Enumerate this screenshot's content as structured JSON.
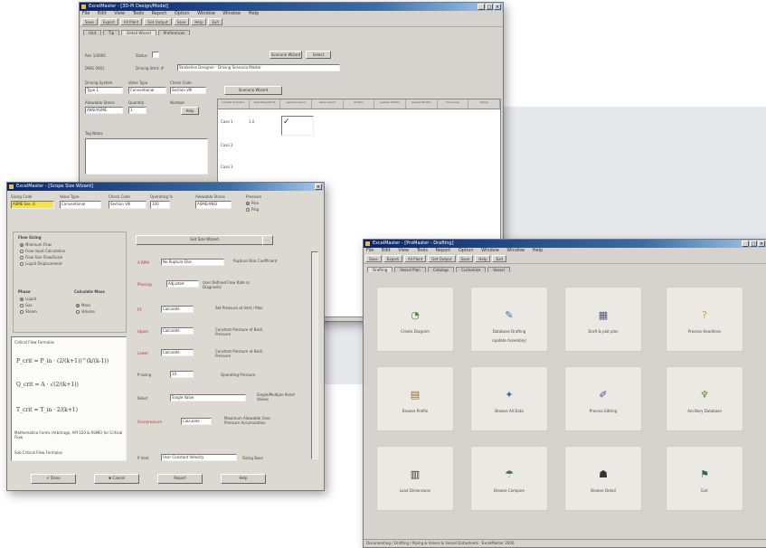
{
  "back_window": {
    "title": "ExcelMaster - [3D-Pi Design/Model]",
    "menu": [
      "File",
      "Edit",
      "View",
      "Tools",
      "Report",
      "Option",
      "Window",
      "Window",
      "Help"
    ],
    "toolbar": [
      "Save",
      "Export",
      "All Plant",
      "Get Output",
      "Save",
      "Help",
      "Exit"
    ],
    "tabs": [
      "Unit",
      "Tip",
      "Detail Wizard",
      "Preferences"
    ],
    "fields": {
      "rev": "Rev 1/2000",
      "dwg_no": "DWG 0001",
      "status_label": "Status",
      "driving_stmt_label": "Driving Stmt. #",
      "driving_stmt_value": "Strokeline Designer · Driving Scenario Master",
      "drive_type_label": "Driving System",
      "drive_type_value": "Type 1",
      "valve_type_label": "Valve Type",
      "valve_type_value": "Conventional",
      "check_code_label": "Check Code",
      "check_code_value": "Section VIII",
      "allowable_label": "Allowable Stress",
      "allowable_value": "ANSI/ASME",
      "quantity_label": "Quantity",
      "quantity_value": "1",
      "number_label": "Number",
      "tag_notes_label": "Tag Notes",
      "scenario_wizard": "Scenario Wizard",
      "help_btn": "Help",
      "select_btn": "Select"
    },
    "grid_headers": [
      "Leaded Scenario",
      "Operating Mode",
      "Leaded Liquid",
      "Valve Liquid",
      "Molten",
      "Leaded Molten",
      "Leaded Molten",
      "Flow Area",
      "Sizing"
    ],
    "grid_rows": [
      "Case 1",
      "Case 2",
      "Case 3"
    ],
    "grid_value": "1.0",
    "check_mark": "✓"
  },
  "front_left_window": {
    "title": "ExcelMaster - [Scope Size Wizard]",
    "fields": {
      "sizing_code_label": "Sizing Code",
      "sizing_code_value": "ASME Sec. 8",
      "valve_type_label": "Valve Type",
      "valve_type_value": "Conventional",
      "check_code_label": "Check Code",
      "check_code_value": "Section VIII",
      "operating_label": "Operating %",
      "operating_value": "100",
      "allowable_label": "Allowable Stress",
      "allowable_value": "ASME/ANSI",
      "pressure_label": "Pressure",
      "pressure_opts": [
        "Psia",
        "Psig"
      ]
    },
    "flow_group": {
      "title": "Flow Sizing",
      "options": [
        "Minimum Flow",
        "Flow Input Calculation",
        "Flow Size Flow/Scale",
        "Liquid Displacement"
      ]
    },
    "phase_group": {
      "title": "Phase",
      "options": [
        "Liquid",
        "Gas",
        "Steam"
      ]
    },
    "calc_group": {
      "title": "Calculate Mass",
      "options": [
        "Mass",
        "Volume"
      ]
    },
    "critical_label": "Critical Flow Formulas",
    "formulas": [
      "P_crit = P_in · (2/(k+1))^(k/(k-1))",
      "Q_crit = A · √(2/(k+1))",
      "T_crit = T_in · 2/(k+1)"
    ],
    "formula_note": "Mathematica Forms (Arbitrage, API 520 & ASME) for Critical Flow",
    "formula_footer": "Sub Critical Flow Formulas",
    "right_panel": {
      "button": "Get Size Wizard",
      "rows": [
        {
          "label": "A RPM",
          "value": "No Rupture Disc",
          "note": "Rupture Disk Coefficient"
        },
        {
          "label": "Phasing",
          "value": "Adjusted",
          "note": "User Defined Flow Rate or Diagnostic"
        },
        {
          "label": "P1",
          "value": "Calculate",
          "note": "Set Pressure at Inlet / Max"
        },
        {
          "label": "Upper",
          "value": "Calculate",
          "note": "Constant Pressure of Back Pressure"
        },
        {
          "label": "Lower",
          "value": "Calculate",
          "note": "Constant Pressure at Back Pressure"
        },
        {
          "label": "P-sizing",
          "value": "10",
          "note": "Operating Pressure"
        },
        {
          "label": "Relief",
          "value": "Single Valve",
          "note": "Single/Multiple Relief Valves"
        },
        {
          "label": "Overpressure",
          "value": "Calculate",
          "note": "Maximum Allowable Over Pressure Accumulation"
        },
        {
          "label": "P Inlet",
          "value": "User Constant Velocity",
          "note": "Sizing Base"
        }
      ]
    },
    "buttons": [
      "Done",
      "Cancel",
      "Report",
      "Help"
    ]
  },
  "front_right_window": {
    "title": "ExcelMaster - [ProMaster - Drafting]",
    "menu": [
      "File",
      "Edit",
      "View",
      "Tools",
      "Report",
      "Option",
      "Window",
      "Window",
      "Help"
    ],
    "toolbar": [
      "Save",
      "Export",
      "All Plant",
      "Get Output",
      "Save",
      "Help",
      "Exit"
    ],
    "tabs": [
      "Drafting",
      "Vessel Plan",
      "Catalogs",
      "Customize",
      "Vessel"
    ],
    "tiles": [
      {
        "icon": "◔",
        "color": "#4a8a3a",
        "label": "Create Diagram"
      },
      {
        "icon": "✎",
        "color": "#3a6a9a",
        "label": "Database Drafting",
        "sub": "(update Assembly)"
      },
      {
        "icon": "▦",
        "color": "#555577",
        "label": "Draft & plot plan"
      },
      {
        "icon": "?",
        "color": "#c8a030",
        "label": "Process Headlines"
      },
      {
        "icon": "▤",
        "color": "#8a6a2a",
        "label": "Browse Profile"
      },
      {
        "icon": "✦",
        "color": "#4466aa",
        "label": "Browse All Data"
      },
      {
        "icon": "✐",
        "color": "#4444aa",
        "label": "Process Editing"
      },
      {
        "icon": "♆",
        "color": "#6a8a2a",
        "label": "Ancillary Database"
      },
      {
        "icon": "▥",
        "color": "#333333",
        "label": "Load Dimensions"
      },
      {
        "icon": "☂",
        "color": "#4a6a4a",
        "label": "Browse Compare"
      },
      {
        "icon": "☗",
        "color": "#333333",
        "label": "Browse Detail"
      },
      {
        "icon": "⚑",
        "color": "#2a6a5a",
        "label": "Exit"
      }
    ],
    "status": "Documenting / Drafting / Piping & Valves & Vessel Datasheets · ExcelMaster 2006"
  }
}
